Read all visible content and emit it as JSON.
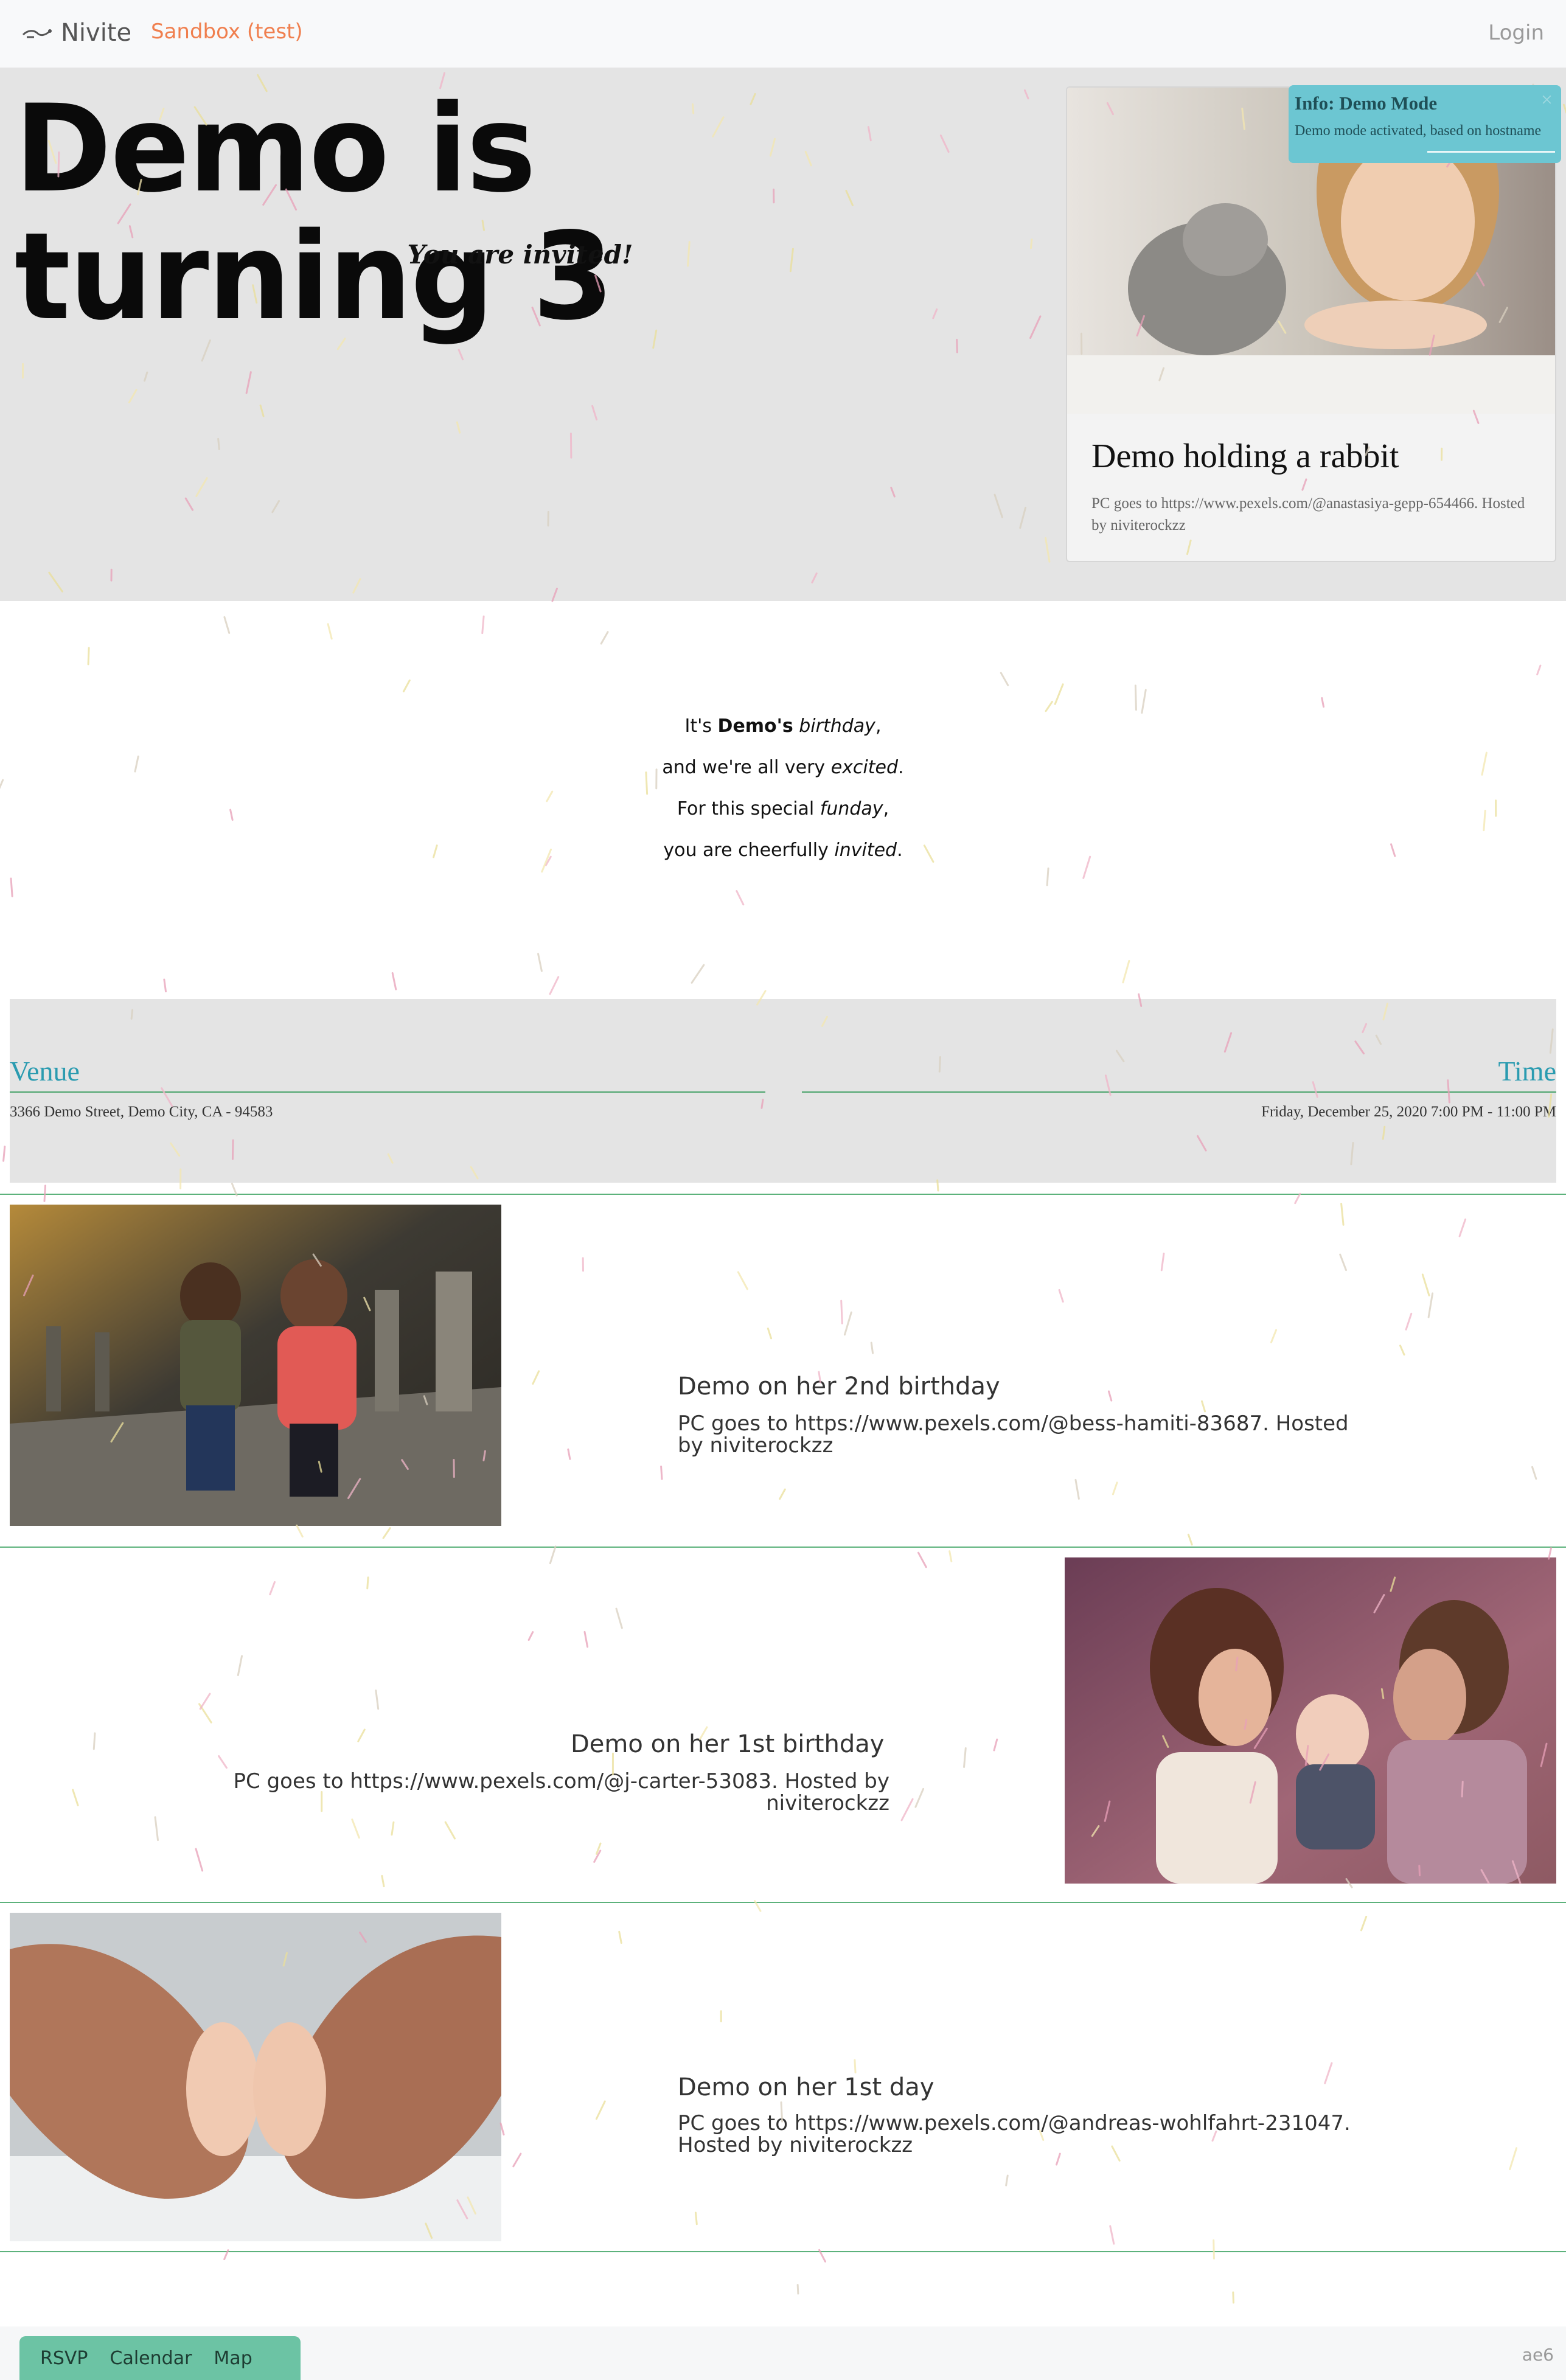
{
  "navbar": {
    "brand": "Nivite",
    "environment": "Sandbox (test)",
    "login": "Login"
  },
  "hero": {
    "title": "Demo is turning 3",
    "subtitle": "You are invited!",
    "card": {
      "title": "Demo holding a rabbit",
      "text": "PC goes to https://www.pexels.com/@anastasiya-gepp-654466. Hosted by niviterockzz"
    }
  },
  "alert": {
    "title": "Info: Demo Mode",
    "message": "Demo mode activated, based on hostname",
    "close": "×"
  },
  "poem": {
    "line1": {
      "a": "It's ",
      "b": "Demo's",
      "c": " ",
      "d": "birthday",
      "e": ","
    },
    "line2": {
      "a": "and we're all very ",
      "b": "excited",
      "c": "."
    },
    "line3": {
      "a": "For this special ",
      "b": "funday",
      "c": ","
    },
    "line4": {
      "a": "you are cheerfully ",
      "b": "invited",
      "c": "."
    }
  },
  "info": {
    "venue_label": "Venue",
    "venue_value": "3366 Demo Street, Demo City, CA - 94583",
    "time_label": "Time",
    "time_value": "Friday, December 25, 2020 7:00 PM - 11:00 PM"
  },
  "gallery": [
    {
      "title": "Demo on her 2nd birthday",
      "text": "PC goes to https://www.pexels.com/@bess-hamiti-83687. Hosted by niviterockzz"
    },
    {
      "title": "Demo on her 1st birthday",
      "text": "PC goes to https://www.pexels.com/@j-carter-53083. Hosted by niviterockzz"
    },
    {
      "title": "Demo on her 1st day",
      "text": "PC goes to https://www.pexels.com/@andreas-wohlfahrt-231047. Hosted by niviterockzz"
    }
  ],
  "bottombar": {
    "tabs": [
      "RSVP",
      "Calendar",
      "Map"
    ],
    "version": "ae6"
  },
  "colors": {
    "accent_teal": "#2a9bb0",
    "divider_green": "#5cb27b",
    "sandbox_orange": "#f07f4e",
    "tab_green": "#6cc3a4",
    "alert_blue": "#6cc6d2"
  }
}
